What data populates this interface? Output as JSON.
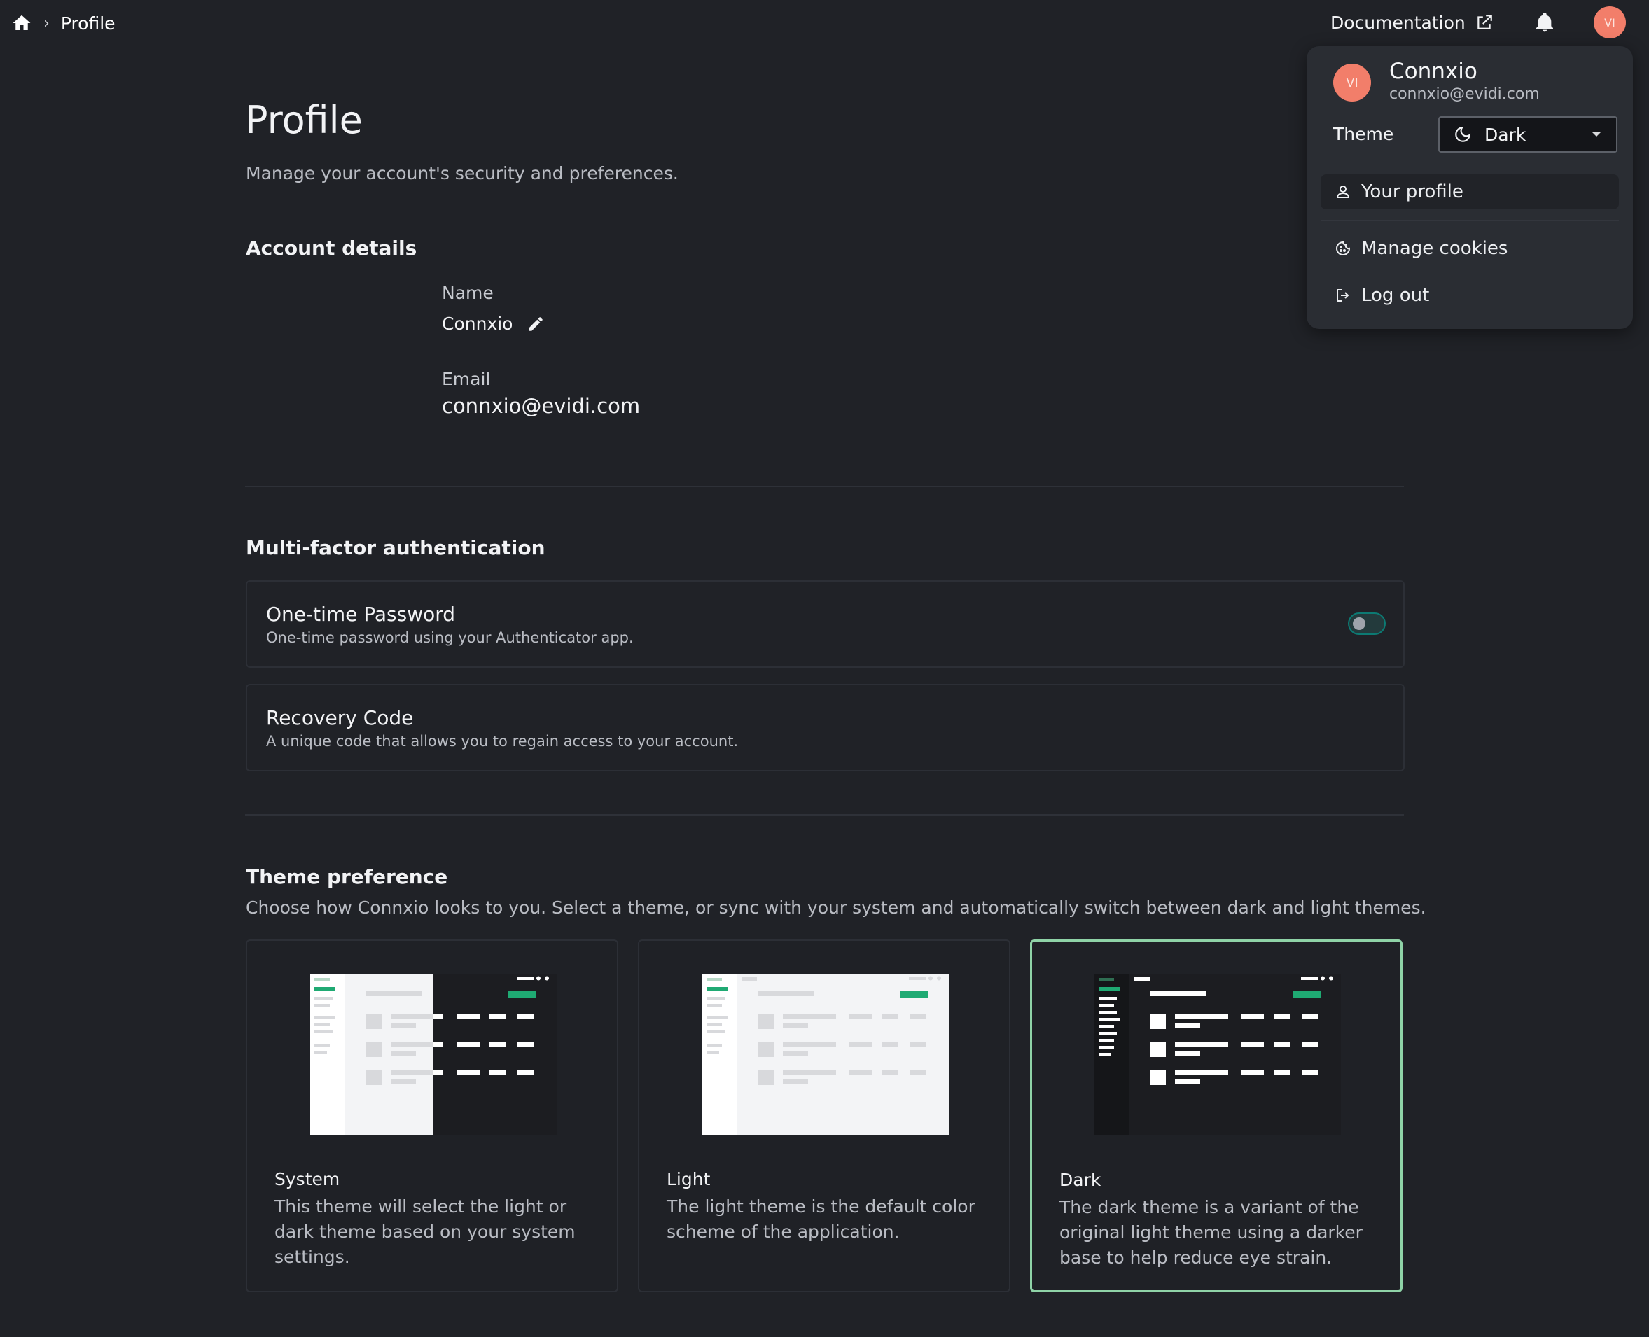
{
  "breadcrumb": {
    "home_icon": "home-icon",
    "current": "Profile"
  },
  "header": {
    "documentation_label": "Documentation",
    "avatar_initials": "VI"
  },
  "page": {
    "title": "Profile",
    "subtitle": "Manage your account's security and preferences."
  },
  "account": {
    "heading": "Account details",
    "name_label": "Name",
    "name_value": "Connxio",
    "email_label": "Email",
    "email_value": "connxio@evidi.com"
  },
  "mfa": {
    "heading": "Multi-factor authentication",
    "otp": {
      "title": "One-time Password",
      "description": "One-time password using your Authenticator app.",
      "enabled": false
    },
    "recovery": {
      "title": "Recovery Code",
      "description": "A unique code that allows you to regain access to your account."
    }
  },
  "theme": {
    "heading": "Theme preference",
    "description": "Choose how Connxio looks to you. Select a theme, or sync with your system and automatically switch between dark and light themes.",
    "options": [
      {
        "name": "System",
        "description": "This theme will select the light or dark theme based on your system settings."
      },
      {
        "name": "Light",
        "description": "The light theme is the default color scheme of the application."
      },
      {
        "name": "Dark",
        "description": "The dark theme is a variant of the original light theme using a darker base to help reduce eye strain."
      }
    ],
    "selected": "Dark",
    "accent_color": "#1faa73"
  },
  "user_menu": {
    "avatar_initials": "VI",
    "name": "Connxio",
    "email": "connxio@evidi.com",
    "theme_label": "Theme",
    "theme_value": "Dark",
    "items": [
      {
        "label": "Your profile",
        "icon": "user-icon"
      },
      {
        "label": "Manage cookies",
        "icon": "cookie-icon"
      },
      {
        "label": "Log out",
        "icon": "logout-icon"
      }
    ]
  },
  "colors": {
    "background": "#202227",
    "avatar": "#f27e6a",
    "selected_border": "#8fd3a7"
  }
}
